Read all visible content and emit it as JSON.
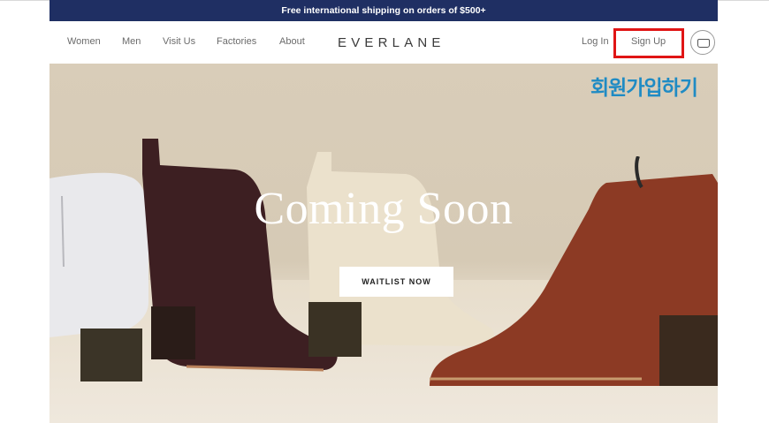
{
  "promo": {
    "text": "Free international shipping on orders of $500+"
  },
  "nav": {
    "links": [
      "Women",
      "Men",
      "Visit Us",
      "Factories",
      "About"
    ],
    "logo": "EVERLANE",
    "login": "Log In",
    "signup": "Sign Up"
  },
  "hero": {
    "title": "Coming Soon",
    "cta": "WAITLIST NOW"
  },
  "annotation": {
    "text": "회원가입하기",
    "color": "#1f8bc4",
    "box_color": "#e01515"
  },
  "colors": {
    "promo_bg": "#1f2f63"
  }
}
